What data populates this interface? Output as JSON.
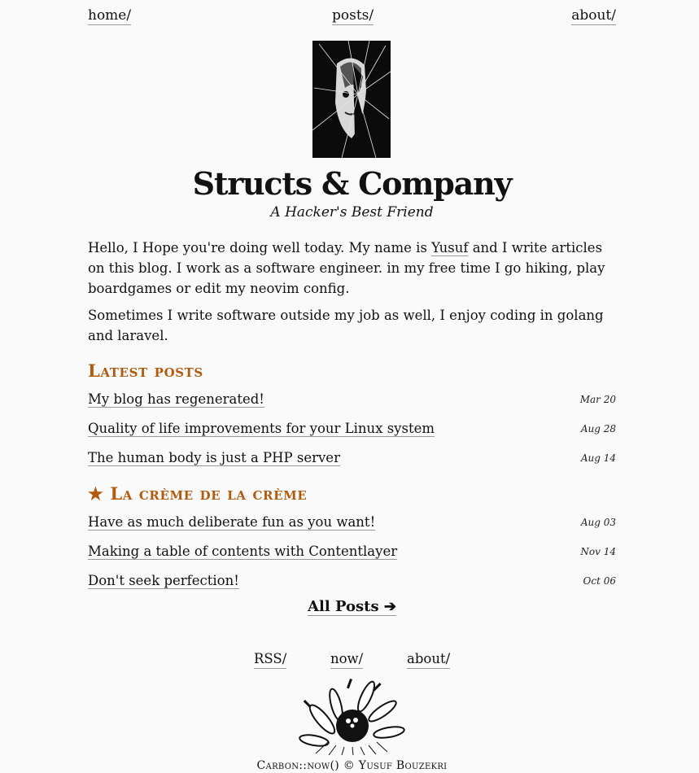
{
  "nav": {
    "home": "home/",
    "posts": "posts/",
    "about": "about/"
  },
  "site": {
    "title": "Structs & Company",
    "subtitle": "A Hacker's Best Friend"
  },
  "intro": {
    "p1_before": "Hello, I Hope you're doing well today. My name is ",
    "name_link": "Yusuf",
    "p1_after": " and I write articles on this blog. I work as a software engineer. in my free time I go hiking, play boardgames or edit my neovim config.",
    "p2": "Sometimes I write software outside my job as well, I enjoy coding in golang and laravel."
  },
  "latest": {
    "heading": "Latest posts",
    "posts": [
      {
        "title": "My blog has regenerated!",
        "date": "Mar 20"
      },
      {
        "title": "Quality of life improvements for your Linux system",
        "date": "Aug 28"
      },
      {
        "title": "The human body is just a PHP server",
        "date": "Aug 14"
      }
    ]
  },
  "featured": {
    "heading": "★ La crème de la crème",
    "posts": [
      {
        "title": "Have as much deliberate fun as you want!",
        "date": "Aug 03"
      },
      {
        "title": "Making a table of contents with Contentlayer",
        "date": "Nov 14"
      },
      {
        "title": "Don't seek perfection!",
        "date": "Oct 06"
      }
    ]
  },
  "all_posts": "All Posts ➔",
  "footer": {
    "links": {
      "rss": "RSS/",
      "now": "now/",
      "about": "about/"
    },
    "copyright": "Carbon::now() © Yusuf Bouzekri"
  },
  "colors": {
    "accent": "#b35a0d",
    "background": "#fafafa",
    "text": "#111111"
  }
}
